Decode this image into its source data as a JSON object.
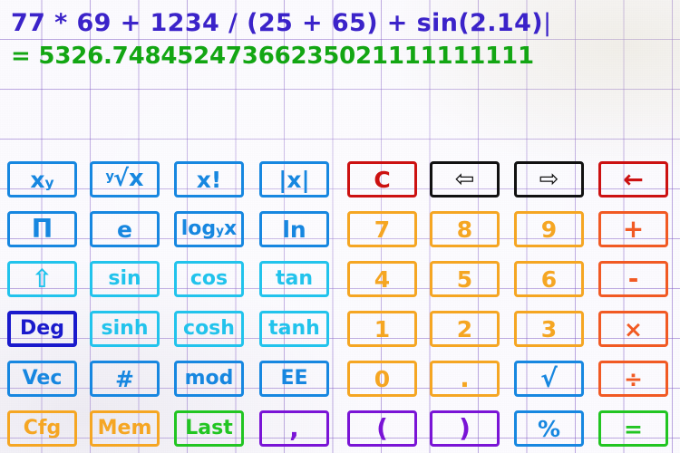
{
  "display": {
    "expression": "77 * 69 + 1234 / (25 + 65) + sin(2.14)",
    "cursor": "|",
    "result": "= 5326.74845247366235021111111111",
    "expression_color": "#3b23c9",
    "result_color": "#13a613"
  },
  "theme": {
    "paper_background": "#fcfbff",
    "grid_line": "#7c56c4",
    "blue": "#1787e0",
    "cyan": "#22c3ec",
    "navy": "#1a1acc",
    "amber": "#f5a623",
    "orange": "#f15a24",
    "red": "#cc1111",
    "black": "#111111",
    "green": "#22c522",
    "purple": "#7a14d6"
  },
  "keypad": {
    "left_panel": [
      [
        {
          "name": "power",
          "label": "x",
          "sup": "y",
          "color": "#1787e0",
          "size": "fs-lg"
        },
        {
          "name": "nth-root",
          "label": "√x",
          "pre": "y",
          "color": "#1787e0",
          "size": "fs-lg"
        },
        {
          "name": "factorial",
          "label": "x!",
          "color": "#1787e0",
          "size": "fs-lg"
        },
        {
          "name": "absolute",
          "label": "|x|",
          "color": "#1787e0",
          "size": "fs-lg"
        }
      ],
      [
        {
          "name": "pi",
          "label": "Π",
          "color": "#1787e0",
          "size": "fs-xl"
        },
        {
          "name": "euler",
          "label": "e",
          "color": "#1787e0",
          "size": "fs-lg"
        },
        {
          "name": "log-base-y",
          "label": "log",
          "sub": "y",
          "tail": "x",
          "color": "#1787e0",
          "size": "fs-md"
        },
        {
          "name": "natural-log",
          "label": "ln",
          "color": "#1787e0",
          "size": "fs-lg"
        }
      ],
      [
        {
          "name": "shift",
          "label": "⇧",
          "color": "#22c3ec",
          "size": "fs-xl"
        },
        {
          "name": "sin",
          "label": "sin",
          "color": "#22c3ec",
          "size": "fs-md"
        },
        {
          "name": "cos",
          "label": "cos",
          "color": "#22c3ec",
          "size": "fs-md"
        },
        {
          "name": "tan",
          "label": "tan",
          "color": "#22c3ec",
          "size": "fs-md"
        }
      ],
      [
        {
          "name": "angle-mode-deg",
          "label": "Deg",
          "color": "#1a1acc",
          "size": "fs-md",
          "weight": "bold"
        },
        {
          "name": "sinh",
          "label": "sinh",
          "color": "#22c3ec",
          "size": "fs-md"
        },
        {
          "name": "cosh",
          "label": "cosh",
          "color": "#22c3ec",
          "size": "fs-md"
        },
        {
          "name": "tanh",
          "label": "tanh",
          "color": "#22c3ec",
          "size": "fs-md"
        }
      ],
      [
        {
          "name": "vector",
          "label": "Vec",
          "color": "#1787e0",
          "size": "fs-md"
        },
        {
          "name": "base-hash",
          "label": "#",
          "color": "#1787e0",
          "size": "fs-lg"
        },
        {
          "name": "modulo",
          "label": "mod",
          "color": "#1787e0",
          "size": "fs-md"
        },
        {
          "name": "exponent-ee",
          "label": "EE",
          "color": "#1787e0",
          "size": "fs-md"
        }
      ],
      [
        {
          "name": "config",
          "label": "Cfg",
          "color": "#f5a623",
          "size": "fs-md"
        },
        {
          "name": "memory",
          "label": "Mem",
          "color": "#f5a623",
          "size": "fs-md"
        },
        {
          "name": "last-answer",
          "label": "Last",
          "color": "#22c522",
          "size": "fs-md"
        },
        {
          "name": "comma",
          "label": ",",
          "color": "#7a14d6",
          "size": "fs-xl"
        }
      ]
    ],
    "right_panel": [
      [
        {
          "name": "clear",
          "label": "C",
          "color": "#cc1111",
          "size": "fs-lg"
        },
        {
          "name": "cursor-left",
          "label": "⇦",
          "color": "#111111",
          "size": "fs-xl",
          "glyph": "arrow-glyph"
        },
        {
          "name": "cursor-right",
          "label": "⇨",
          "color": "#111111",
          "size": "fs-xl",
          "glyph": "arrow-glyph"
        },
        {
          "name": "backspace",
          "label": "←",
          "color": "#cc1111",
          "size": "fs-xl",
          "glyph": "arrow-solid"
        }
      ],
      [
        {
          "name": "digit-7",
          "label": "7",
          "color": "#f5a623",
          "size": "fs-lg"
        },
        {
          "name": "digit-8",
          "label": "8",
          "color": "#f5a623",
          "size": "fs-lg"
        },
        {
          "name": "digit-9",
          "label": "9",
          "color": "#f5a623",
          "size": "fs-lg"
        },
        {
          "name": "plus",
          "label": "+",
          "color": "#f15a24",
          "size": "fs-xl"
        }
      ],
      [
        {
          "name": "digit-4",
          "label": "4",
          "color": "#f5a623",
          "size": "fs-lg"
        },
        {
          "name": "digit-5",
          "label": "5",
          "color": "#f5a623",
          "size": "fs-lg"
        },
        {
          "name": "digit-6",
          "label": "6",
          "color": "#f5a623",
          "size": "fs-lg"
        },
        {
          "name": "minus",
          "label": "-",
          "color": "#f15a24",
          "size": "fs-xl"
        }
      ],
      [
        {
          "name": "digit-1",
          "label": "1",
          "color": "#f5a623",
          "size": "fs-lg"
        },
        {
          "name": "digit-2",
          "label": "2",
          "color": "#f5a623",
          "size": "fs-lg"
        },
        {
          "name": "digit-3",
          "label": "3",
          "color": "#f5a623",
          "size": "fs-lg"
        },
        {
          "name": "multiply",
          "label": "×",
          "color": "#f15a24",
          "size": "fs-lg"
        }
      ],
      [
        {
          "name": "digit-0",
          "label": "0",
          "color": "#f5a623",
          "size": "fs-lg"
        },
        {
          "name": "decimal-point",
          "label": ".",
          "color": "#f5a623",
          "size": "fs-xl"
        },
        {
          "name": "square-root",
          "label": "√",
          "color": "#1787e0",
          "size": "fs-xl"
        },
        {
          "name": "divide",
          "label": "÷",
          "color": "#f15a24",
          "size": "fs-lg"
        }
      ],
      [
        {
          "name": "open-paren",
          "label": "(",
          "color": "#7a14d6",
          "size": "fs-xl"
        },
        {
          "name": "close-paren",
          "label": ")",
          "color": "#7a14d6",
          "size": "fs-xl"
        },
        {
          "name": "percent",
          "label": "%",
          "color": "#1787e0",
          "size": "fs-lg"
        },
        {
          "name": "equals",
          "label": "=",
          "color": "#22c522",
          "size": "fs-lg"
        }
      ]
    ]
  }
}
